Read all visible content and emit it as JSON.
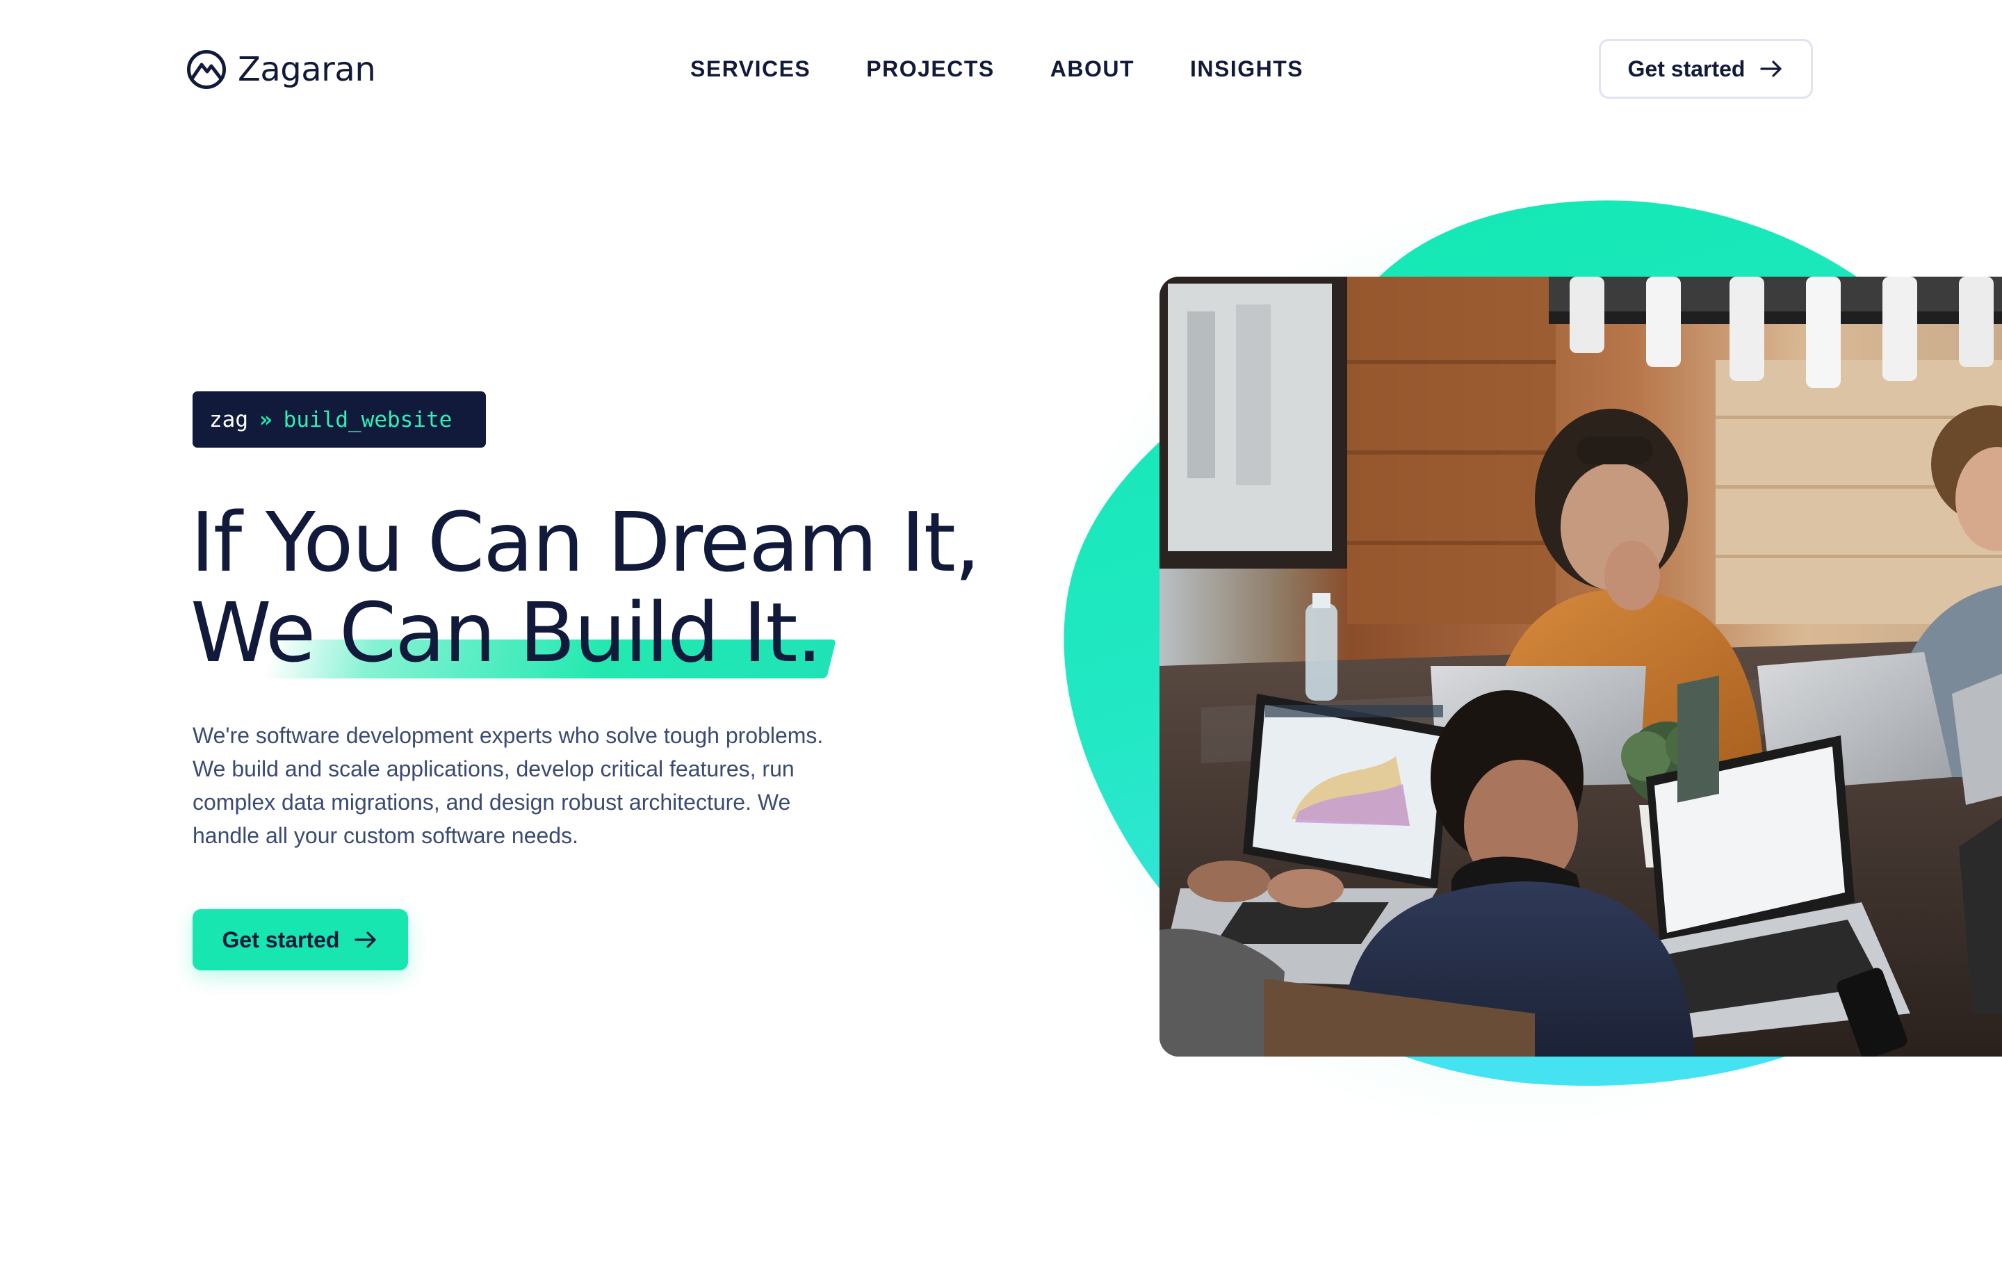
{
  "brand": {
    "name": "Zagaran"
  },
  "nav": {
    "items": [
      {
        "label": "SERVICES"
      },
      {
        "label": "PROJECTS"
      },
      {
        "label": "ABOUT"
      },
      {
        "label": "INSIGHTS"
      }
    ]
  },
  "header": {
    "cta_label": "Get started"
  },
  "hero": {
    "terminal": {
      "prompt": "zag",
      "separator": "»",
      "command": "build_website"
    },
    "headline_line1": "If You Can Dream It,",
    "headline_line2": "We Can Build It.",
    "lead": "We're software development experts who solve tough problems. We build and scale applications, develop critical features, run complex data migrations, and design robust architecture. We handle all your custom software needs.",
    "cta_label": "Get started"
  },
  "icons": {
    "logo": "mountain-circle-logo-icon",
    "cta_arrow": "arrow-right-icon"
  },
  "colors": {
    "navy": "#111a3a",
    "accent_green": "#17e6b0",
    "accent_cyan": "#3ee6f0",
    "body_text": "#3a4a72",
    "button_border": "#dfe3f2"
  }
}
